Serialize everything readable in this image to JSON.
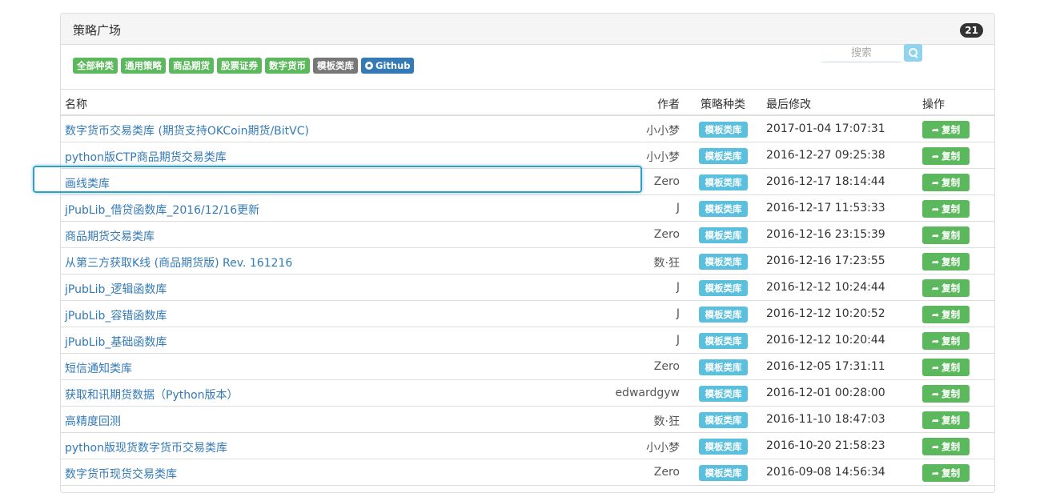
{
  "panel": {
    "title": "策略广场",
    "count": "21"
  },
  "filters": [
    {
      "label": "全部种类",
      "color": "#5cb85c"
    },
    {
      "label": "通用策略",
      "color": "#5cb85c"
    },
    {
      "label": "商品期货",
      "color": "#5cb85c"
    },
    {
      "label": "股票证券",
      "color": "#5cb85c"
    },
    {
      "label": "数字货币",
      "color": "#5cb85c"
    },
    {
      "label": "模板类库",
      "color": "#777777"
    },
    {
      "label": "Github",
      "color": "#337ab7",
      "icon": "github-icon"
    }
  ],
  "search": {
    "placeholder": "搜索",
    "icon": "search-icon"
  },
  "table": {
    "headers": {
      "name": "名称",
      "author": "作者",
      "category": "策略种类",
      "modified": "最后修改",
      "action": "操作"
    },
    "rows": [
      {
        "name": "数字货币交易类库 (期货支持OKCoin期货/BitVC)",
        "author": "小小梦",
        "category": "模板类库",
        "modified": "2017-01-04 17:07:31",
        "action": "复制"
      },
      {
        "name": "python版CTP商品期货交易类库",
        "author": "小小梦",
        "category": "模板类库",
        "modified": "2016-12-27 09:25:38",
        "action": "复制"
      },
      {
        "name": "画线类库",
        "author": "Zero",
        "category": "模板类库",
        "modified": "2016-12-17 18:14:44",
        "action": "复制"
      },
      {
        "name": "jPubLib_借贷函数库_2016/12/16更新",
        "author": "J",
        "category": "模板类库",
        "modified": "2016-12-17 11:53:33",
        "action": "复制"
      },
      {
        "name": "商品期货交易类库",
        "author": "Zero",
        "category": "模板类库",
        "modified": "2016-12-16 23:15:39",
        "action": "复制"
      },
      {
        "name": "从第三方获取K线 (商品期货版) Rev. 161216",
        "author": "数·狂",
        "category": "模板类库",
        "modified": "2016-12-16 17:23:55",
        "action": "复制"
      },
      {
        "name": "jPubLib_逻辑函数库",
        "author": "J",
        "category": "模板类库",
        "modified": "2016-12-12 10:24:44",
        "action": "复制"
      },
      {
        "name": "jPubLib_容错函数库",
        "author": "J",
        "category": "模板类库",
        "modified": "2016-12-12 10:20:52",
        "action": "复制"
      },
      {
        "name": "jPubLib_基础函数库",
        "author": "J",
        "category": "模板类库",
        "modified": "2016-12-12 10:20:44",
        "action": "复制"
      },
      {
        "name": "短信通知类库",
        "author": "Zero",
        "category": "模板类库",
        "modified": "2016-12-05 17:31:11",
        "action": "复制"
      },
      {
        "name": "获取和讯期货数据（Python版本）",
        "author": "edwardgyw",
        "category": "模板类库",
        "modified": "2016-12-01 00:28:00",
        "action": "复制"
      },
      {
        "name": "高精度回测",
        "author": "数·狂",
        "category": "模板类库",
        "modified": "2016-11-10 18:47:03",
        "action": "复制"
      },
      {
        "name": "python版现货数字货币交易类库",
        "author": "小小梦",
        "category": "模板类库",
        "modified": "2016-10-20 21:58:23",
        "action": "复制"
      },
      {
        "name": "数字货币现货交易类库",
        "author": "Zero",
        "category": "模板类库",
        "modified": "2016-09-08 14:56:34",
        "action": "复制"
      }
    ]
  }
}
